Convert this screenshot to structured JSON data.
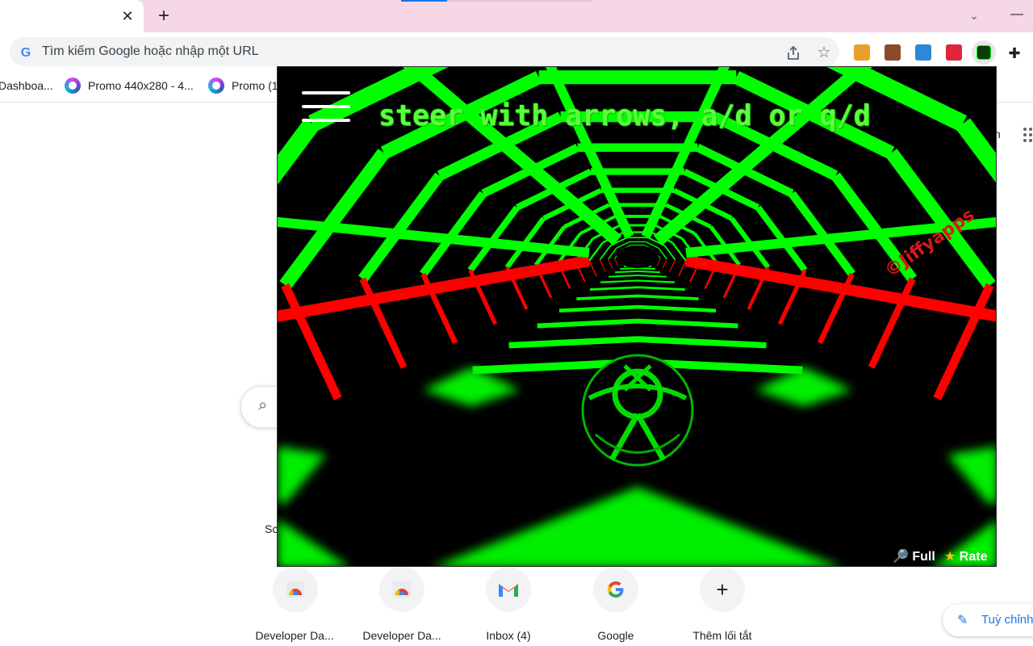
{
  "browser": {
    "tab_close_glyph": "✕",
    "new_tab_glyph": "+",
    "tab_search_glyph": "⌄",
    "minimize_glyph": "—",
    "omnibox_placeholder": "Tìm kiếm Google hoặc nhập một URL",
    "google_glyph": "G",
    "star_glyph": "☆",
    "puzzle_glyph": "✚",
    "extensions": [
      "extension-1-icon",
      "extension-2-icon",
      "extension-3-icon",
      "extension-4-icon",
      "slope-game-extension-icon"
    ]
  },
  "bookmarks": [
    {
      "label": "Dashboa..."
    },
    {
      "label": "Promo 440x280 - 4..."
    },
    {
      "label": "Promo (1"
    }
  ],
  "ntp": {
    "partial_text": "Sc",
    "right_text": "n",
    "shortcuts": [
      {
        "label": "Developer Da...",
        "icon": "webstore-icon"
      },
      {
        "label": "Developer Da...",
        "icon": "webstore-icon"
      },
      {
        "label": "Inbox (4)",
        "icon": "gmail-icon"
      },
      {
        "label": "Google",
        "icon": "google-icon"
      },
      {
        "label": "Thêm lối tắt",
        "icon": "add-icon",
        "glyph": "+"
      }
    ],
    "customize_label": "Tuỳ chỉnh",
    "customize_glyph": "✎"
  },
  "game": {
    "hint": "steer with arrows, a/d or q/d",
    "watermark": "©Jiffyapps",
    "full_label": "Full",
    "full_glyph": "🔎",
    "rate_label": "Rate",
    "rate_glyph": "★",
    "colors": {
      "green": "#00ff00",
      "red": "#ff0000",
      "background": "#000000"
    }
  }
}
